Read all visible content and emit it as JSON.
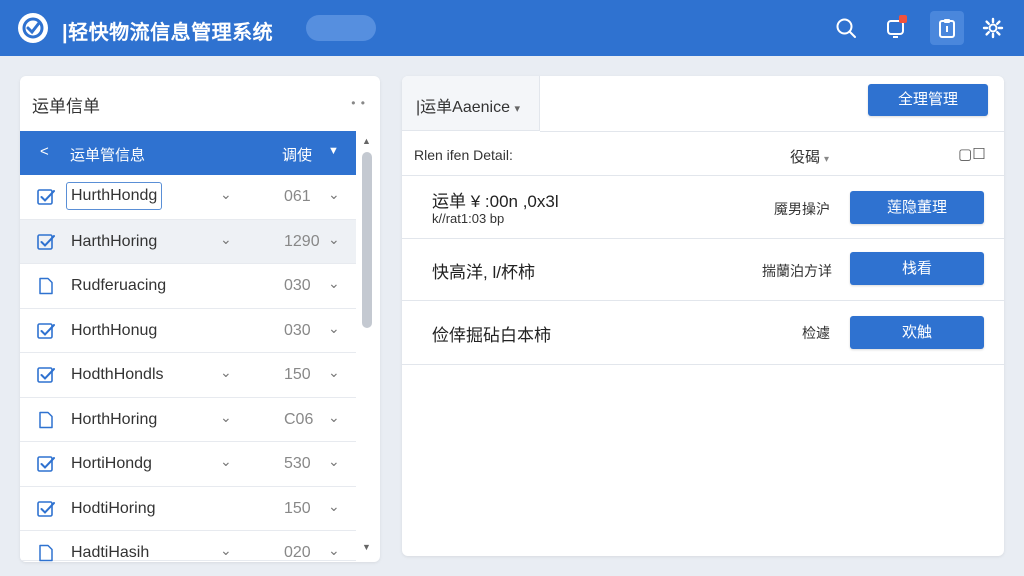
{
  "header": {
    "title": "|轻快物流信息管理系统",
    "icons": [
      "logo-icon",
      "search-icon",
      "notification-icon",
      "clipboard-icon",
      "settings-icon"
    ],
    "accent": "#2f72d0",
    "badge_color": "#f0523c"
  },
  "left_panel": {
    "title": "运单信单",
    "more": "• •",
    "list_header": {
      "back": "<",
      "label": "运单管信息",
      "column": "调使",
      "caret": "▼"
    },
    "rows": [
      {
        "name": "HurthHondg",
        "num": "061",
        "checked": true,
        "has_chevron": true,
        "boxed": true,
        "selected": false
      },
      {
        "name": "HarthHoring",
        "num": "1290",
        "checked": true,
        "has_chevron": true,
        "boxed": false,
        "selected": true
      },
      {
        "name": "Rudferuacing",
        "num": "030",
        "checked": false,
        "has_chevron": false,
        "boxed": false,
        "selected": false
      },
      {
        "name": "HorthHonug",
        "num": "030",
        "checked": true,
        "has_chevron": false,
        "boxed": false,
        "selected": false
      },
      {
        "name": "HodthHondls",
        "num": "150",
        "checked": true,
        "has_chevron": true,
        "boxed": false,
        "selected": false
      },
      {
        "name": "HorthHoring",
        "num": "C06",
        "checked": false,
        "has_chevron": true,
        "boxed": false,
        "selected": false
      },
      {
        "name": "HortiHondg",
        "num": "530",
        "checked": true,
        "has_chevron": true,
        "boxed": false,
        "selected": false
      },
      {
        "name": "HodtiHoring",
        "num": "150",
        "checked": true,
        "has_chevron": false,
        "boxed": false,
        "selected": false
      },
      {
        "name": "HadtiHasih",
        "num": "020",
        "checked": false,
        "has_chevron": true,
        "boxed": false,
        "selected": false
      }
    ]
  },
  "right_panel": {
    "tab_label": "|运单Aaenice",
    "tab_caret": "▾",
    "top_button": "全理管理",
    "detail_header": {
      "label": "Rlen ifen Detail:",
      "sort": "役碣",
      "sort_caret": "▾",
      "toggle": "▢☐"
    },
    "detail_rows": [
      {
        "title": "运单 ¥ :00n ,0x3l",
        "sub": "k//rat1:03 bp",
        "action": "魇男操沪",
        "button": "莲隐董理"
      },
      {
        "title": "快高洋, l/杯柿",
        "sub": "",
        "action": "揣蘭泊方详",
        "button": "栈看"
      },
      {
        "title": "俭倖掘砧白本柿",
        "sub": "",
        "action": "检遽",
        "button": "欢触"
      }
    ]
  }
}
